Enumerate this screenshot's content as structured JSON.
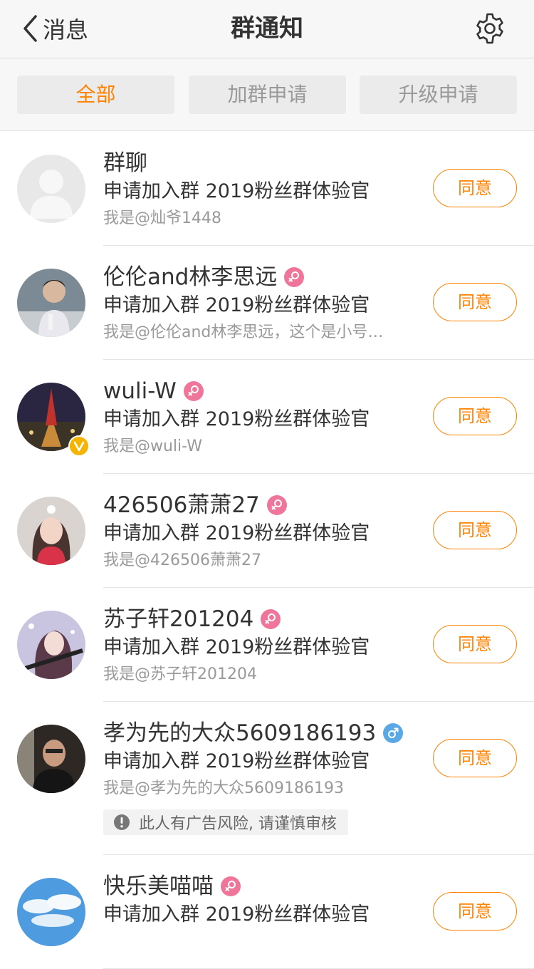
{
  "nav": {
    "back_label": "消息",
    "title": "群通知",
    "back_icon": "chevron-left-icon",
    "settings_icon": "gear-icon"
  },
  "tabs": [
    {
      "label": "全部",
      "active": true
    },
    {
      "label": "加群申请",
      "active": false
    },
    {
      "label": "升级申请",
      "active": false
    }
  ],
  "colors": {
    "accent": "#ff8200",
    "female": "#f0759b",
    "male": "#5aa8e6",
    "verified": "#f5b400"
  },
  "requests": [
    {
      "name": "群聊",
      "gender": "",
      "desc": "申请加入群 2019粉丝群体验官",
      "message": "我是@灿爷1448",
      "action": "同意"
    },
    {
      "name": "伦伦and林李思远",
      "gender": "female",
      "desc": "申请加入群 2019粉丝群体验官",
      "message": "我是@伦伦and林李思远，这个是小号…",
      "action": "同意"
    },
    {
      "name": "wuli-W",
      "gender": "female",
      "verified": true,
      "desc": "申请加入群 2019粉丝群体验官",
      "message": "我是@wuli-W",
      "action": "同意"
    },
    {
      "name": "426506萧萧27",
      "gender": "female",
      "desc": "申请加入群 2019粉丝群体验官",
      "message": "我是@426506萧萧27",
      "action": "同意"
    },
    {
      "name": "苏子轩201204",
      "gender": "female",
      "desc": "申请加入群 2019粉丝群体验官",
      "message": "我是@苏子轩201204",
      "action": "同意"
    },
    {
      "name": "孝为先的大众5609186193",
      "gender": "male",
      "desc": "申请加入群 2019粉丝群体验官",
      "message": "我是@孝为先的大众5609186193",
      "warning": "此人有广告风险, 请谨慎审核",
      "action": "同意"
    },
    {
      "name": "快乐美喵喵",
      "gender": "female",
      "desc": "申请加入群 2019粉丝群体验官",
      "message": "",
      "action": "同意"
    }
  ]
}
